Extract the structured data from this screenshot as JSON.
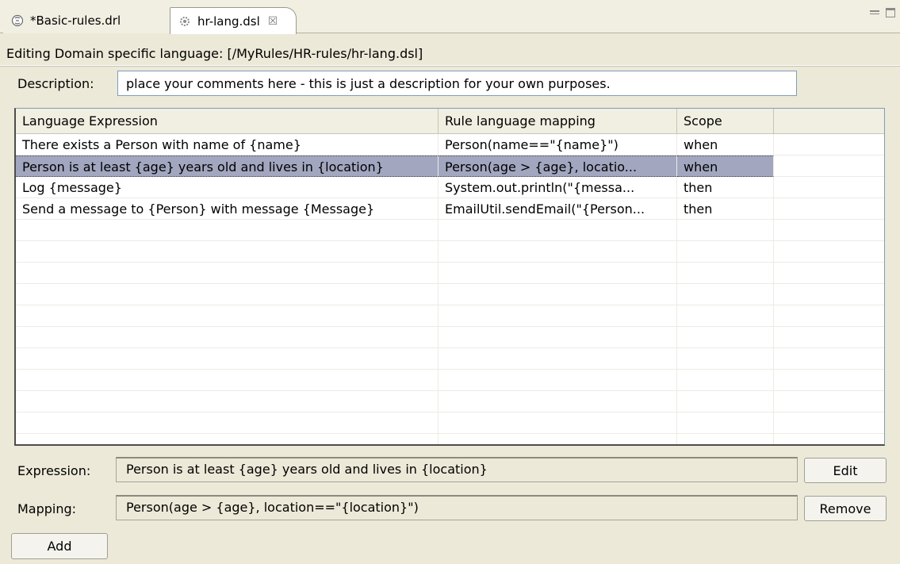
{
  "tabs": [
    {
      "label": "*Basic-rules.drl",
      "icon": "drools-file-icon",
      "active": false
    },
    {
      "label": "hr-lang.dsl",
      "icon": "dsl-gear-icon",
      "active": true,
      "close": "☒"
    }
  ],
  "editor": {
    "heading": "Editing Domain specific language: [/MyRules/HR-rules/hr-lang.dsl]"
  },
  "description": {
    "label": "Description:",
    "value": "place your comments here - this is just a description for your own purposes."
  },
  "table": {
    "columns": [
      "Language Expression",
      "Rule language mapping",
      "Scope",
      ""
    ],
    "rows": [
      {
        "expression": "There exists a Person with name of {name}",
        "mapping": "Person(name==\"{name}\")",
        "scope": "when",
        "selected": false
      },
      {
        "expression": "Person is at least {age} years old and lives in {location}",
        "mapping": "Person(age > {age}, locatio...",
        "scope": "when",
        "selected": true
      },
      {
        "expression": "Log {message}",
        "mapping": "System.out.println(\"{messa...",
        "scope": "then",
        "selected": false
      },
      {
        "expression": "Send a message to {Person} with message {Message}",
        "mapping": "EmailUtil.sendEmail(\"{Person...",
        "scope": "then",
        "selected": false
      }
    ],
    "empty_rows": 11
  },
  "form": {
    "expression_label": "Expression:",
    "expression_value": "Person is at least {age} years old and lives in {location}",
    "mapping_label": "Mapping:",
    "mapping_value": "Person(age > {age}, location==\"{location}\")",
    "edit_label": "Edit",
    "remove_label": "Remove",
    "add_label": "Add"
  },
  "colors": {
    "selection": "#a2a6bf",
    "background": "#ece9d8",
    "border": "#7f9db9"
  }
}
